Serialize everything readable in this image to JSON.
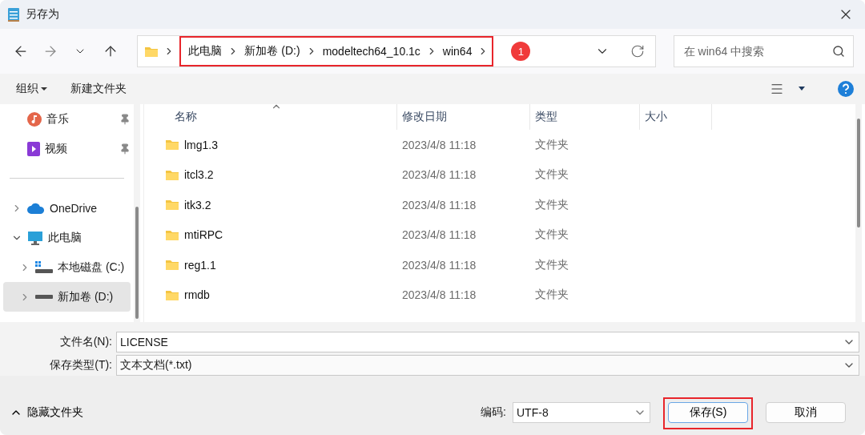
{
  "window": {
    "title": "另存为"
  },
  "address": {
    "crumbs": [
      "此电脑",
      "新加卷 (D:)",
      "modeltech64_10.1c",
      "win64"
    ],
    "highlighted": true,
    "badge": "1"
  },
  "search": {
    "placeholder": "在 win64 中搜索"
  },
  "toolbar": {
    "organize": "组织",
    "new_folder": "新建文件夹"
  },
  "sidebar": {
    "quick_access": [
      {
        "kind": "music",
        "label": "音乐",
        "pinned": true,
        "selected": false
      },
      {
        "kind": "video",
        "label": "视频",
        "pinned": true,
        "selected": false
      }
    ],
    "tree": [
      {
        "kind": "cloud",
        "label": "OneDrive",
        "expanded": false,
        "selected": false
      },
      {
        "kind": "pc",
        "label": "此电脑",
        "expanded": true,
        "selected": false,
        "children": [
          {
            "kind": "system-drive",
            "label": "本地磁盘 (C:)",
            "expanded": false,
            "selected": false
          },
          {
            "kind": "drive",
            "label": "新加卷 (D:)",
            "expanded": false,
            "selected": true
          }
        ]
      }
    ]
  },
  "table": {
    "columns": [
      {
        "label": "名称",
        "sorted": true
      },
      {
        "label": "修改日期",
        "sorted": false
      },
      {
        "label": "类型",
        "sorted": false
      },
      {
        "label": "大小",
        "sorted": false
      }
    ],
    "rows": [
      {
        "name": "lmg1.3",
        "date": "2023/4/8 11:18",
        "type": "文件夹"
      },
      {
        "name": "itcl3.2",
        "date": "2023/4/8 11:18",
        "type": "文件夹"
      },
      {
        "name": "itk3.2",
        "date": "2023/4/8 11:18",
        "type": "文件夹"
      },
      {
        "name": "mtiRPC",
        "date": "2023/4/8 11:18",
        "type": "文件夹"
      },
      {
        "name": "reg1.1",
        "date": "2023/4/8 11:18",
        "type": "文件夹"
      },
      {
        "name": "rmdb",
        "date": "2023/4/8 11:18",
        "type": "文件夹"
      }
    ]
  },
  "form": {
    "file_name": {
      "label": "文件名(N):",
      "value": "LICENSE"
    },
    "save_type": {
      "label": "保存类型(T):",
      "value": "文本文档(*.txt)"
    }
  },
  "footer": {
    "hide_folders": "隐藏文件夹",
    "encoding": {
      "label": "编码:",
      "value": "UTF-8"
    },
    "buttons": [
      {
        "kind": "save",
        "label": "保存(S)",
        "highlighted": true
      },
      {
        "kind": "cancel",
        "label": "取消",
        "highlighted": false
      }
    ]
  }
}
